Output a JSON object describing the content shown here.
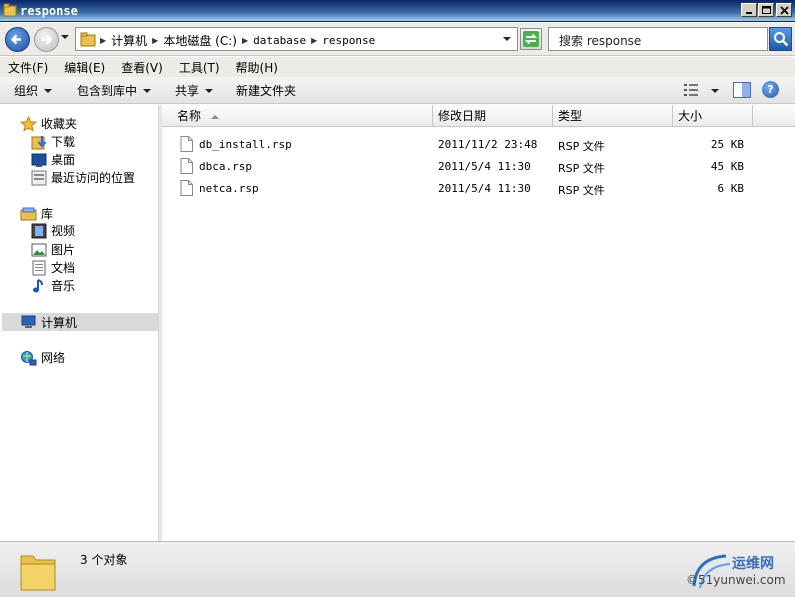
{
  "window": {
    "title": "response"
  },
  "address": {
    "crumbs": [
      "计算机",
      "本地磁盘 (C:)",
      "database",
      "response"
    ]
  },
  "search": {
    "placeholder": "搜索 response"
  },
  "menu": {
    "items": [
      "文件(F)",
      "编辑(E)",
      "查看(V)",
      "工具(T)",
      "帮助(H)"
    ]
  },
  "commands": {
    "organize": "组织",
    "include_in_library": "包含到库中",
    "share": "共享",
    "new_folder": "新建文件夹"
  },
  "nav": {
    "favorites": "收藏夹",
    "downloads": "下载",
    "desktop": "桌面",
    "recent": "最近访问的位置",
    "libraries": "库",
    "videos": "视频",
    "pictures": "图片",
    "documents": "文档",
    "music": "音乐",
    "computer": "计算机",
    "network": "网络"
  },
  "columns": {
    "name": "名称",
    "modified": "修改日期",
    "type": "类型",
    "size": "大小"
  },
  "files": [
    {
      "name": "db_install.rsp",
      "modified": "2011/11/2 23:48",
      "type": "RSP 文件",
      "size": "25 KB"
    },
    {
      "name": "dbca.rsp",
      "modified": "2011/5/4 11:30",
      "type": "RSP 文件",
      "size": "45 KB"
    },
    {
      "name": "netca.rsp",
      "modified": "2011/5/4 11:30",
      "type": "RSP 文件",
      "size": "6 KB"
    }
  ],
  "status": {
    "count": "3 个对象"
  },
  "watermark": {
    "brand": "运维网",
    "site": "©51yunwei.com"
  },
  "colors": {
    "title_bar": "#0a246a",
    "folder": "#e8c14e",
    "selected_nav": "#d9d9d9"
  }
}
